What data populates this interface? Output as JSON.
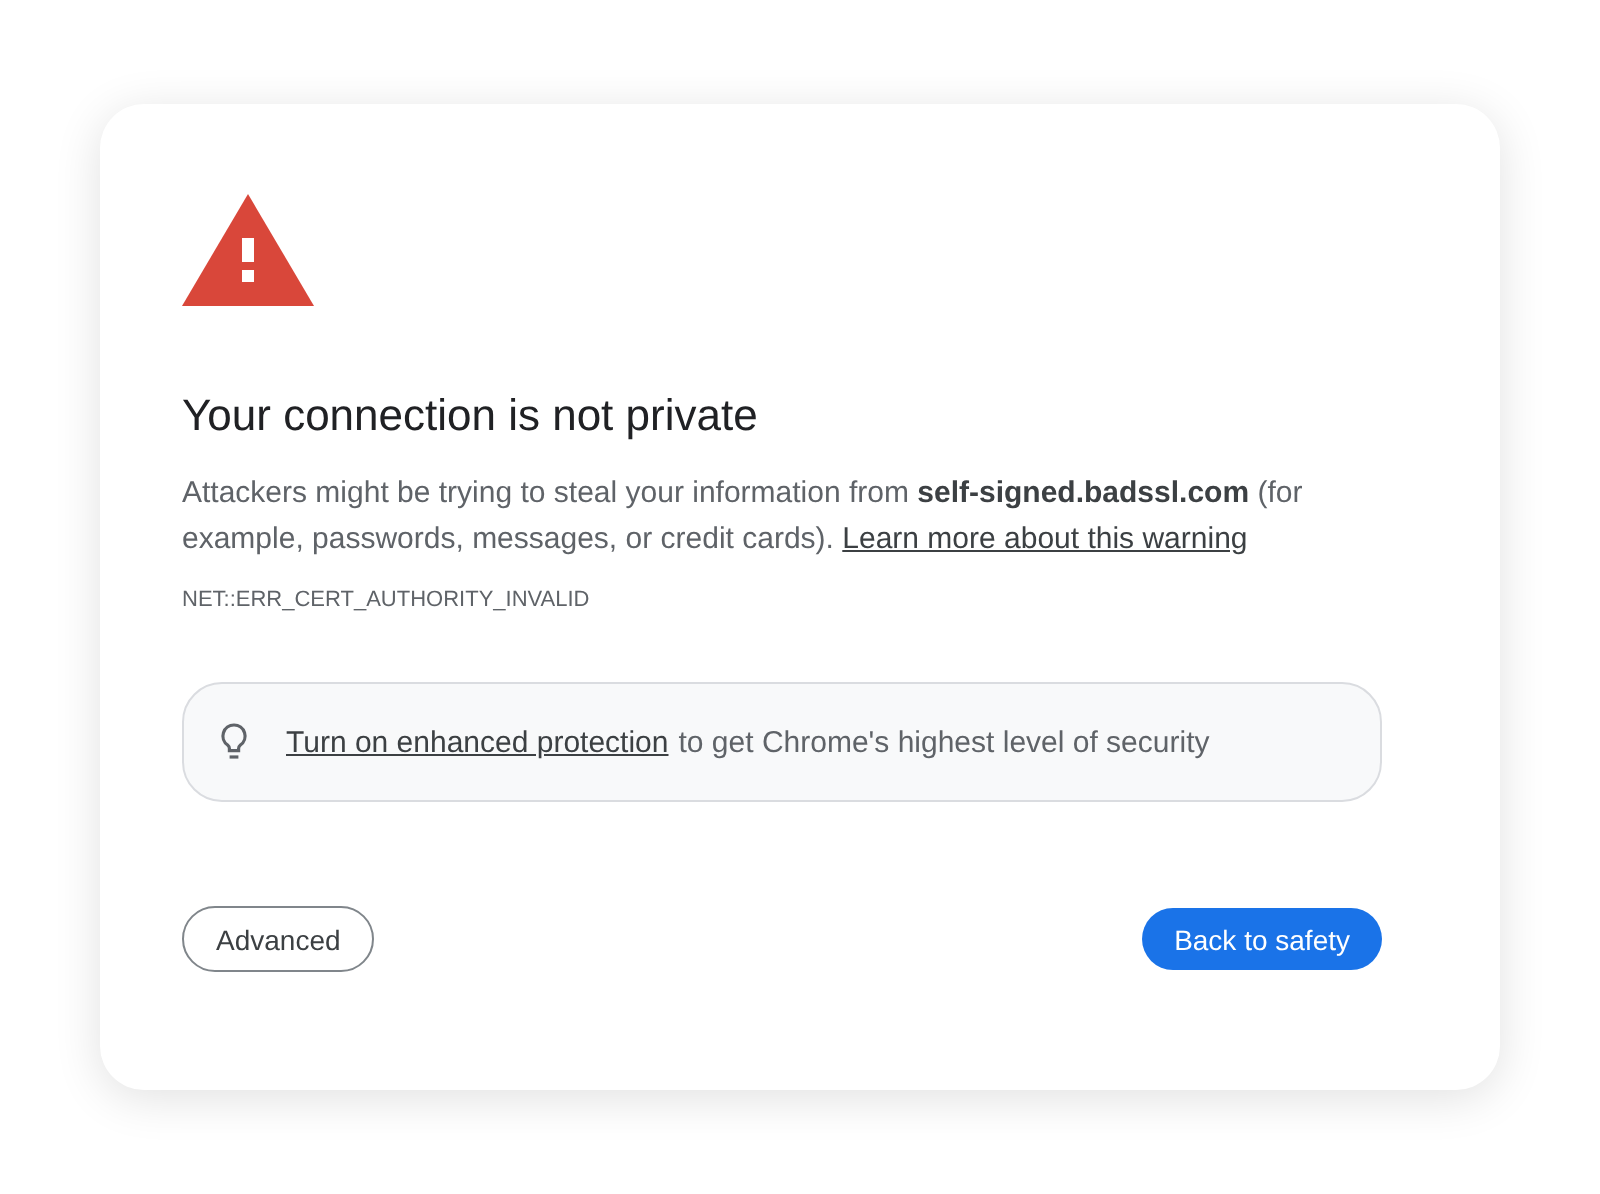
{
  "title": "Your connection is not private",
  "message": {
    "text": "Attackers might be trying to steal your information from **self-signed.badssl.com** (for example, passwords, messages, or credit cards).",
    "link": "Learn more about this warning"
  },
  "error_code": "NET::ERR_CERT_AUTHORITY_INVALID",
  "protection_banner": {
    "link": "Turn on enhanced protection",
    "text": "to get Chrome's highest level of security"
  },
  "buttons": [
    {
      "label": "Advanced",
      "kind": "secondary"
    },
    {
      "label": "Back to safety",
      "kind": "primary"
    }
  ]
}
